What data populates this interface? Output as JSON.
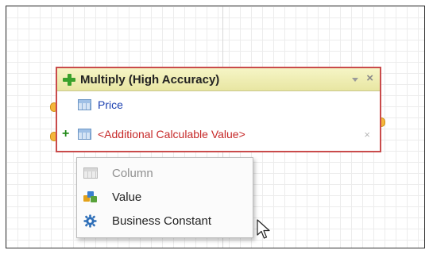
{
  "node": {
    "title": "Multiply (High Accuracy)",
    "icon": "plus-icon",
    "header_close_glyph": "×",
    "rows": [
      {
        "label": "Price",
        "icon": "table-icon",
        "color": "#1a3fb0"
      },
      {
        "label": "<Additional Calculable Value>",
        "icon": "table-icon",
        "color": "#c62828",
        "prefix_glyph": "+",
        "remove_glyph": "×"
      }
    ]
  },
  "menu": {
    "items": [
      {
        "label": "Column",
        "icon": "column-table-icon",
        "disabled": true
      },
      {
        "label": "Value",
        "icon": "cubes-icon",
        "disabled": false
      },
      {
        "label": "Business Constant",
        "icon": "gear-icon",
        "disabled": false
      }
    ]
  },
  "colors": {
    "node_border": "#c94b4b",
    "header_bg": "#f0eeb5",
    "connector": "#f4b63a"
  }
}
